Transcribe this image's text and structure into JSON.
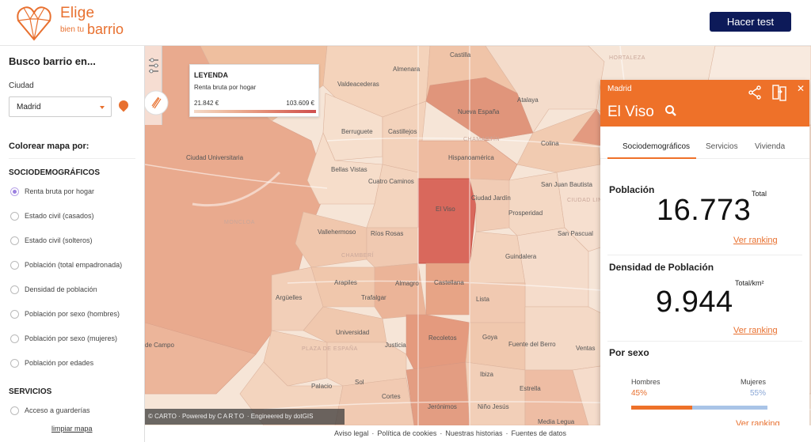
{
  "header": {
    "brand_line1": "Elige",
    "brand_line2a": "bien tu",
    "brand_line2b": "barrio",
    "test_button": "Hacer test",
    "colors": {
      "brand_orange": "#e8702f",
      "button_navy": "#0d1a59"
    }
  },
  "sidebar": {
    "title": "Busco barrio en...",
    "city_label": "Ciudad",
    "city_value": "Madrid",
    "color_by": "Colorear mapa por:",
    "section_socio": "SOCIODEMOGRÁFICOS",
    "options": [
      "Renta bruta por hogar",
      "Estado civil (casados)",
      "Estado civil (solteros)",
      "Población (total empadronada)",
      "Densidad de población",
      "Población por sexo (hombres)",
      "Población por sexo (mujeres)",
      "Población por edades"
    ],
    "selected_option": "Renta bruta por hogar",
    "section_services": "SERVICIOS",
    "service_options": [
      "Acceso a guarderías"
    ],
    "clear_link": "limpiar mapa"
  },
  "map": {
    "legend": {
      "title": "LEYENDA",
      "subtitle": "Renta bruta por hogar",
      "min": "21.842 €",
      "max": "103.609 €"
    },
    "labels": {
      "castilla": "Castilla",
      "almenara": "Almenara",
      "valdeacederas": "Valdeacederas",
      "hortaleza": "HORTALEZA",
      "atalaya": "Atalaya",
      "nueva_espana": "Nueva España",
      "berruguete": "Berruguete",
      "castillejos": "Castillejos",
      "chamartin": "CHAMARTÍN",
      "colina": "Colina",
      "ciudad_universitaria": "Ciudad Universitaria",
      "hispanoamerica": "Hispanoamérica",
      "bellas_vistas": "Bellas Vistas",
      "cuatro_caminos": "Cuatro Caminos",
      "san_juan_bautista": "San Juan Bautista",
      "ciudad_lineal": "CIUDAD LINEAL",
      "ciudad_jardin": "Ciudad Jardín",
      "el_viso": "El Viso",
      "prosperidad": "Prosperidad",
      "moncloa": "MONCLOA",
      "vallehermoso": "Vallehermoso",
      "rios_rosas": "Ríos Rosas",
      "san_pascual": "San Pascual",
      "chamberi": "CHAMBERÍ",
      "guindalera": "Guindalera",
      "arapiles": "Arapiles",
      "almagro": "Almagro",
      "castellana": "Castellana",
      "arguelles": "Argüelles",
      "trafalgar": "Trafalgar",
      "lista": "Lista",
      "universidad": "Universidad",
      "recoletos": "Recoletos",
      "goya": "Goya",
      "casa_de_campo": "de Campo",
      "plaza_espana": "PLAZA DE ESPAÑA",
      "justicia": "Justicia",
      "fuente_del_berro": "Fuente del Berro",
      "ventas": "Ventas",
      "ibiza": "Ibiza",
      "palacio": "Palacio",
      "sol": "Sol",
      "estrella": "Estrella",
      "cortes": "Cortes",
      "jeronimos": "Jerónimos",
      "nino_jesus": "Niño Jesús",
      "media_legua": "Media Legua"
    },
    "attribution": {
      "carto": "© CARTO",
      "powered_by": "Powered by",
      "carto_logo": "CARTO",
      "engineered": "Engineered by dotGIS"
    }
  },
  "panel": {
    "city": "Madrid",
    "neighborhood": "El Viso",
    "tabs": [
      "Sociodemográficos",
      "Servicios",
      "Vivienda"
    ],
    "active_tab": "Sociodemográficos",
    "poblacion": {
      "title": "Población",
      "value": "16.773",
      "unit": "Total",
      "ranking": "Ver ranking"
    },
    "densidad": {
      "title": "Densidad de Población",
      "value": "9.944",
      "unit": "Total/km²",
      "ranking": "Ver ranking"
    },
    "sexo": {
      "title": "Por sexo",
      "hombres_label": "Hombres",
      "mujeres_label": "Mujeres",
      "hombres_pct": "45%",
      "mujeres_pct": "55%",
      "ranking": "Ver ranking",
      "hombres_share": 0.45,
      "mujeres_share": 0.55
    },
    "colors": {
      "header_orange": "#ee7129",
      "men_orange": "#ee7129",
      "women_blue": "#a9c4e7"
    }
  },
  "footer": {
    "links": [
      "Aviso legal",
      "Política de cookies",
      "Nuestras historias",
      "Fuentes de datos"
    ]
  }
}
